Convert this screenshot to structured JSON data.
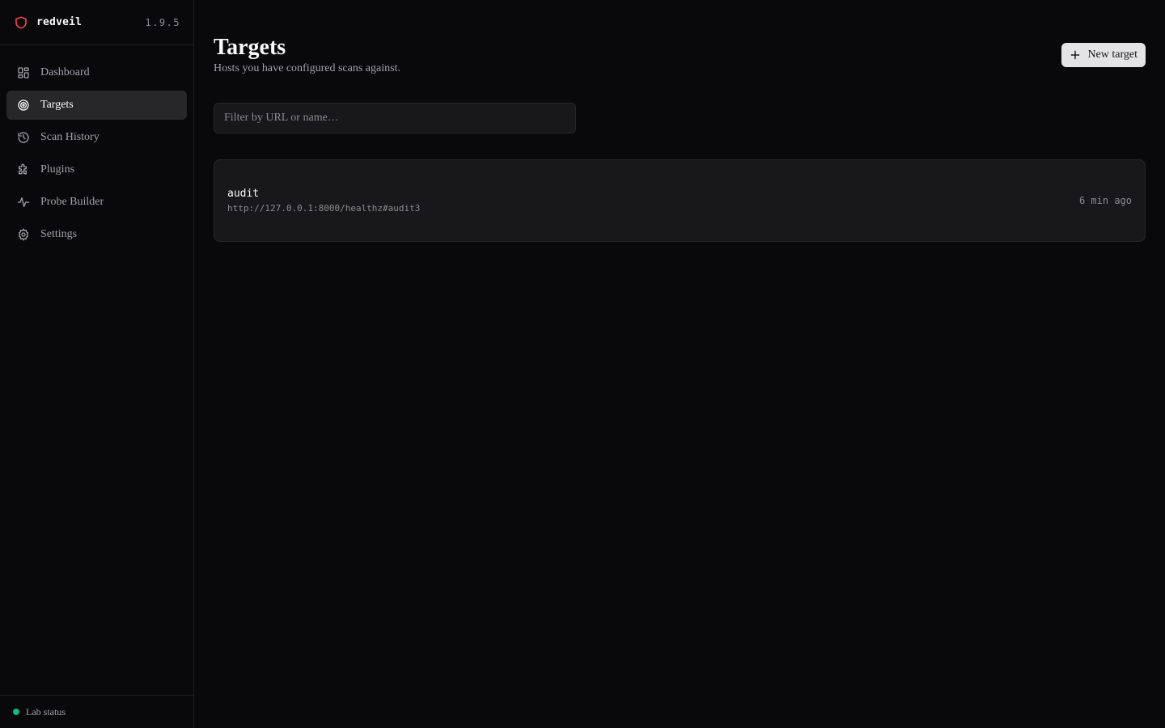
{
  "brand": {
    "name": "redveil",
    "version": "1.9.5",
    "logo_icon": "shield-icon",
    "accent": "#ef4444"
  },
  "sidebar": {
    "items": [
      {
        "label": "Dashboard",
        "icon": "dashboard-icon",
        "active": false
      },
      {
        "label": "Targets",
        "icon": "target-icon",
        "active": true
      },
      {
        "label": "Scan History",
        "icon": "history-icon",
        "active": false
      },
      {
        "label": "Plugins",
        "icon": "puzzle-icon",
        "active": false
      },
      {
        "label": "Probe Builder",
        "icon": "waveform-icon",
        "active": false
      },
      {
        "label": "Settings",
        "icon": "gear-icon",
        "active": false
      }
    ],
    "footer": {
      "status_label": "Lab status",
      "status_color": "#10b981"
    }
  },
  "page": {
    "title": "Targets",
    "subtitle": "Hosts you have configured scans against.",
    "new_button_label": "New target"
  },
  "filter": {
    "placeholder": "Filter by URL or name…",
    "value": ""
  },
  "targets": [
    {
      "name": "audit",
      "url": "http://127.0.0.1:8000/healthz#audit3",
      "updated": "6 min ago"
    }
  ]
}
